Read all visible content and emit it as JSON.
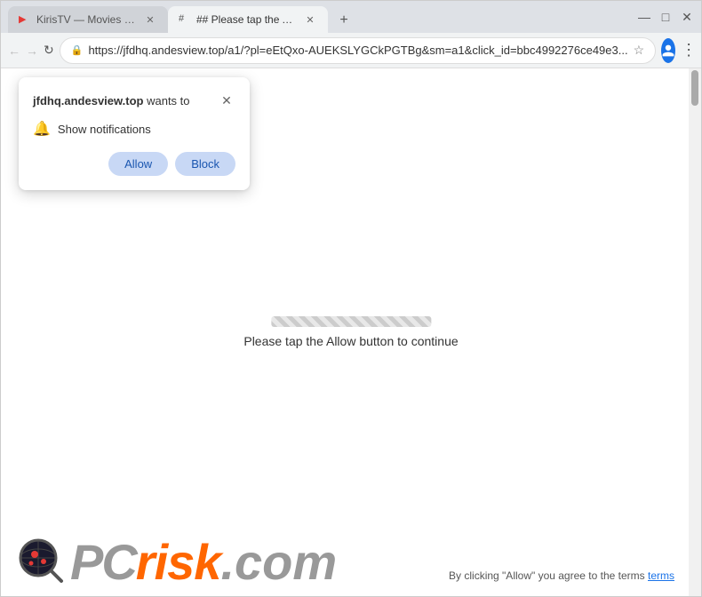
{
  "browser": {
    "tabs": [
      {
        "id": "tab1",
        "title": "KirisTV — Movies and Series D...",
        "favicon": "▶",
        "active": false
      },
      {
        "id": "tab2",
        "title": "## Please tap the Allow button...",
        "favicon": "#",
        "active": true
      }
    ],
    "url": "https://jfdhq.andesview.top/a1/?pl=eEtQxo-AUEKSLYGCkPGTBg&sm=a1&click_id=bbc4992276ce49e3...",
    "window_controls": {
      "minimize": "—",
      "maximize": "□",
      "close": "✕"
    }
  },
  "popup": {
    "site": "jfdhq.andesview.top",
    "wants_to": " wants to",
    "notification_text": "Show notifications",
    "allow_label": "Allow",
    "block_label": "Block"
  },
  "page": {
    "loading_text": "Please tap the Allow button to continue"
  },
  "bottom": {
    "logo_pc": "PC",
    "logo_risk": "risk",
    "logo_com": ".com",
    "byline": "By clicking \"Allow\" you agree to the terms"
  }
}
